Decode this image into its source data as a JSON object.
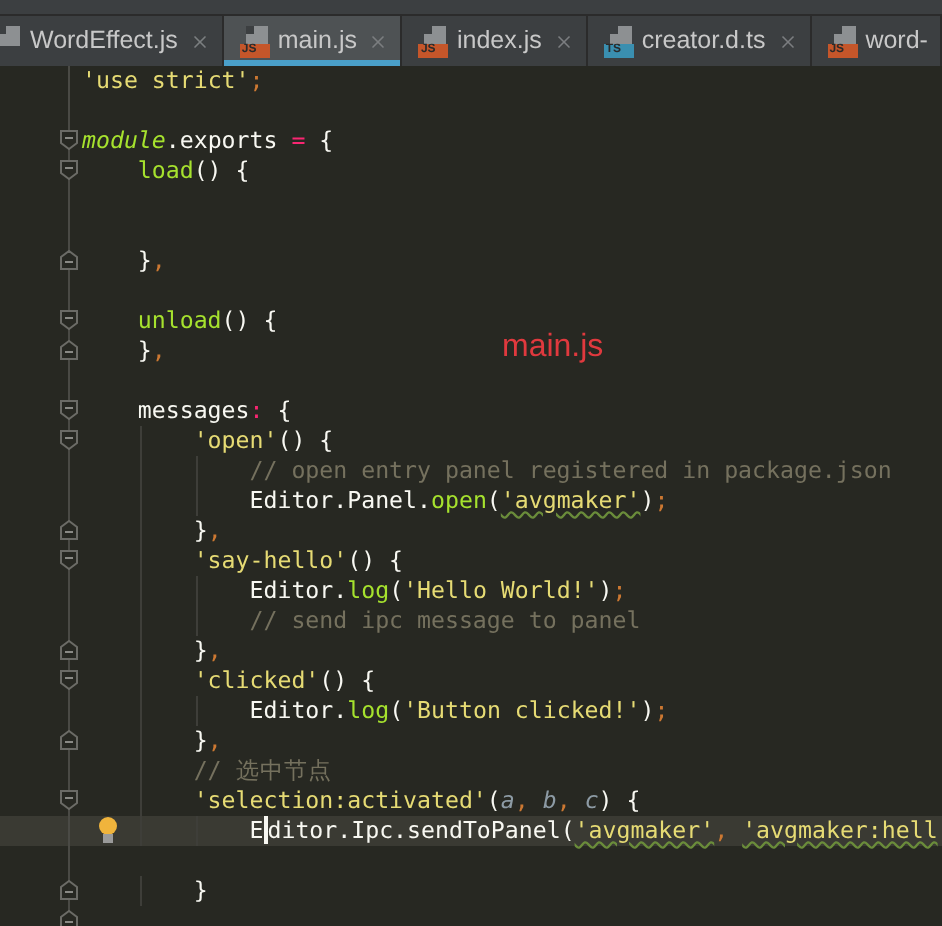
{
  "tabs": [
    {
      "label": "WordEffect.js",
      "selected": false,
      "closable": true
    },
    {
      "label": "main.js",
      "file_type": "JS",
      "selected": true,
      "closable": true
    },
    {
      "label": "index.js",
      "file_type": "JS",
      "selected": false,
      "closable": true
    },
    {
      "label": "creator.d.ts",
      "file_type": "TS",
      "selected": false,
      "closable": true
    },
    {
      "label": "word-",
      "file_type": "JS",
      "selected": false
    }
  ],
  "editor": {
    "lines": [
      {
        "kind": "code",
        "tokens": [
          {
            "kind": "string",
            "text": "'use strict'"
          },
          {
            "kind": "punct",
            "text": ";"
          }
        ]
      },
      {
        "kind": "blank"
      },
      {
        "kind": "code",
        "fold_open": true,
        "tokens": [
          {
            "kind": "keyword",
            "text": "module"
          },
          {
            "kind": "plain",
            "text": ".exports "
          },
          {
            "kind": "op",
            "text": "="
          },
          {
            "kind": "plain",
            "text": " {"
          }
        ]
      },
      {
        "kind": "code",
        "fold_open": true,
        "tokens": [
          {
            "kind": "func",
            "text": "    load"
          },
          {
            "kind": "plain",
            "text": "() {"
          }
        ]
      },
      {
        "kind": "blank"
      },
      {
        "kind": "blank"
      },
      {
        "kind": "code",
        "fold_close": true,
        "tokens": [
          {
            "kind": "plain",
            "text": "    }"
          },
          {
            "kind": "punct",
            "text": ","
          }
        ]
      },
      {
        "kind": "blank"
      },
      {
        "kind": "code",
        "fold_open": true,
        "tokens": [
          {
            "kind": "func",
            "text": "    unload"
          },
          {
            "kind": "plain",
            "text": "() {"
          }
        ]
      },
      {
        "kind": "code",
        "fold_close": true,
        "tokens": [
          {
            "kind": "plain",
            "text": "    }"
          },
          {
            "kind": "punct",
            "text": ","
          }
        ]
      },
      {
        "kind": "blank"
      },
      {
        "kind": "code",
        "fold_open": true,
        "tokens": [
          {
            "kind": "plain",
            "text": "    messages"
          },
          {
            "kind": "op",
            "text": ":"
          },
          {
            "kind": "plain",
            "text": " {"
          }
        ]
      },
      {
        "kind": "code",
        "fold_open": true,
        "tokens": [
          {
            "kind": "string",
            "text": "        'open'"
          },
          {
            "kind": "plain",
            "text": "() {"
          }
        ]
      },
      {
        "kind": "code",
        "tokens": [
          {
            "kind": "comment",
            "text": "            // open entry panel registered in package.json"
          }
        ]
      },
      {
        "kind": "code",
        "tokens": [
          {
            "kind": "plain",
            "text": "            Editor.Panel."
          },
          {
            "kind": "func",
            "text": "open"
          },
          {
            "kind": "plain",
            "text": "("
          },
          {
            "kind": "string",
            "text": "'avgmaker'",
            "warn": true
          },
          {
            "kind": "plain",
            "text": ")"
          },
          {
            "kind": "punct",
            "text": ";"
          }
        ]
      },
      {
        "kind": "code",
        "fold_close": true,
        "tokens": [
          {
            "kind": "plain",
            "text": "        }"
          },
          {
            "kind": "punct",
            "text": ","
          }
        ]
      },
      {
        "kind": "code",
        "fold_open": true,
        "tokens": [
          {
            "kind": "string",
            "text": "        'say-hello'"
          },
          {
            "kind": "plain",
            "text": "() {"
          }
        ]
      },
      {
        "kind": "code",
        "tokens": [
          {
            "kind": "plain",
            "text": "            Editor."
          },
          {
            "kind": "func",
            "text": "log"
          },
          {
            "kind": "plain",
            "text": "("
          },
          {
            "kind": "string",
            "text": "'Hello World!'"
          },
          {
            "kind": "plain",
            "text": ")"
          },
          {
            "kind": "punct",
            "text": ";"
          }
        ]
      },
      {
        "kind": "code",
        "tokens": [
          {
            "kind": "comment",
            "text": "            // send ipc message to panel"
          }
        ]
      },
      {
        "kind": "code",
        "fold_close": true,
        "tokens": [
          {
            "kind": "plain",
            "text": "        }"
          },
          {
            "kind": "punct",
            "text": ","
          }
        ]
      },
      {
        "kind": "code",
        "fold_open": true,
        "tokens": [
          {
            "kind": "string",
            "text": "        'clicked'"
          },
          {
            "kind": "plain",
            "text": "() {"
          }
        ]
      },
      {
        "kind": "code",
        "tokens": [
          {
            "kind": "plain",
            "text": "            Editor."
          },
          {
            "kind": "func",
            "text": "log"
          },
          {
            "kind": "plain",
            "text": "("
          },
          {
            "kind": "string",
            "text": "'Button clicked!'"
          },
          {
            "kind": "plain",
            "text": ")"
          },
          {
            "kind": "punct",
            "text": ";"
          }
        ]
      },
      {
        "kind": "code",
        "fold_close": true,
        "tokens": [
          {
            "kind": "plain",
            "text": "        }"
          },
          {
            "kind": "punct",
            "text": ","
          }
        ]
      },
      {
        "kind": "code",
        "tokens": [
          {
            "kind": "comment",
            "text": "        // 选中节点"
          }
        ]
      },
      {
        "kind": "code",
        "fold_open": true,
        "tokens": [
          {
            "kind": "string",
            "text": "        'selection:activated'"
          },
          {
            "kind": "plain",
            "text": "("
          },
          {
            "kind": "param",
            "text": "a"
          },
          {
            "kind": "punct",
            "text": ", "
          },
          {
            "kind": "param",
            "text": "b"
          },
          {
            "kind": "punct",
            "text": ", "
          },
          {
            "kind": "param",
            "text": "c"
          },
          {
            "kind": "plain",
            "text": ") {"
          }
        ]
      },
      {
        "kind": "code",
        "current": true,
        "bulb": true,
        "tokens": [
          {
            "kind": "plain",
            "text": "            E"
          },
          {
            "kind": "caret"
          },
          {
            "kind": "plain",
            "text": "ditor.Ipc.sendToPanel("
          },
          {
            "kind": "string",
            "text": "'avgmaker'",
            "warn": true
          },
          {
            "kind": "punct",
            "text": ", "
          },
          {
            "kind": "string",
            "text": "'avgmaker:hell",
            "warn": true
          }
        ]
      },
      {
        "kind": "blank"
      },
      {
        "kind": "code",
        "fold_close": true,
        "tokens": [
          {
            "kind": "plain",
            "text": "        }"
          }
        ]
      },
      {
        "kind": "blank",
        "fold_close": true
      }
    ]
  },
  "annotation": {
    "text": "main.js",
    "color": "#e0393e"
  }
}
